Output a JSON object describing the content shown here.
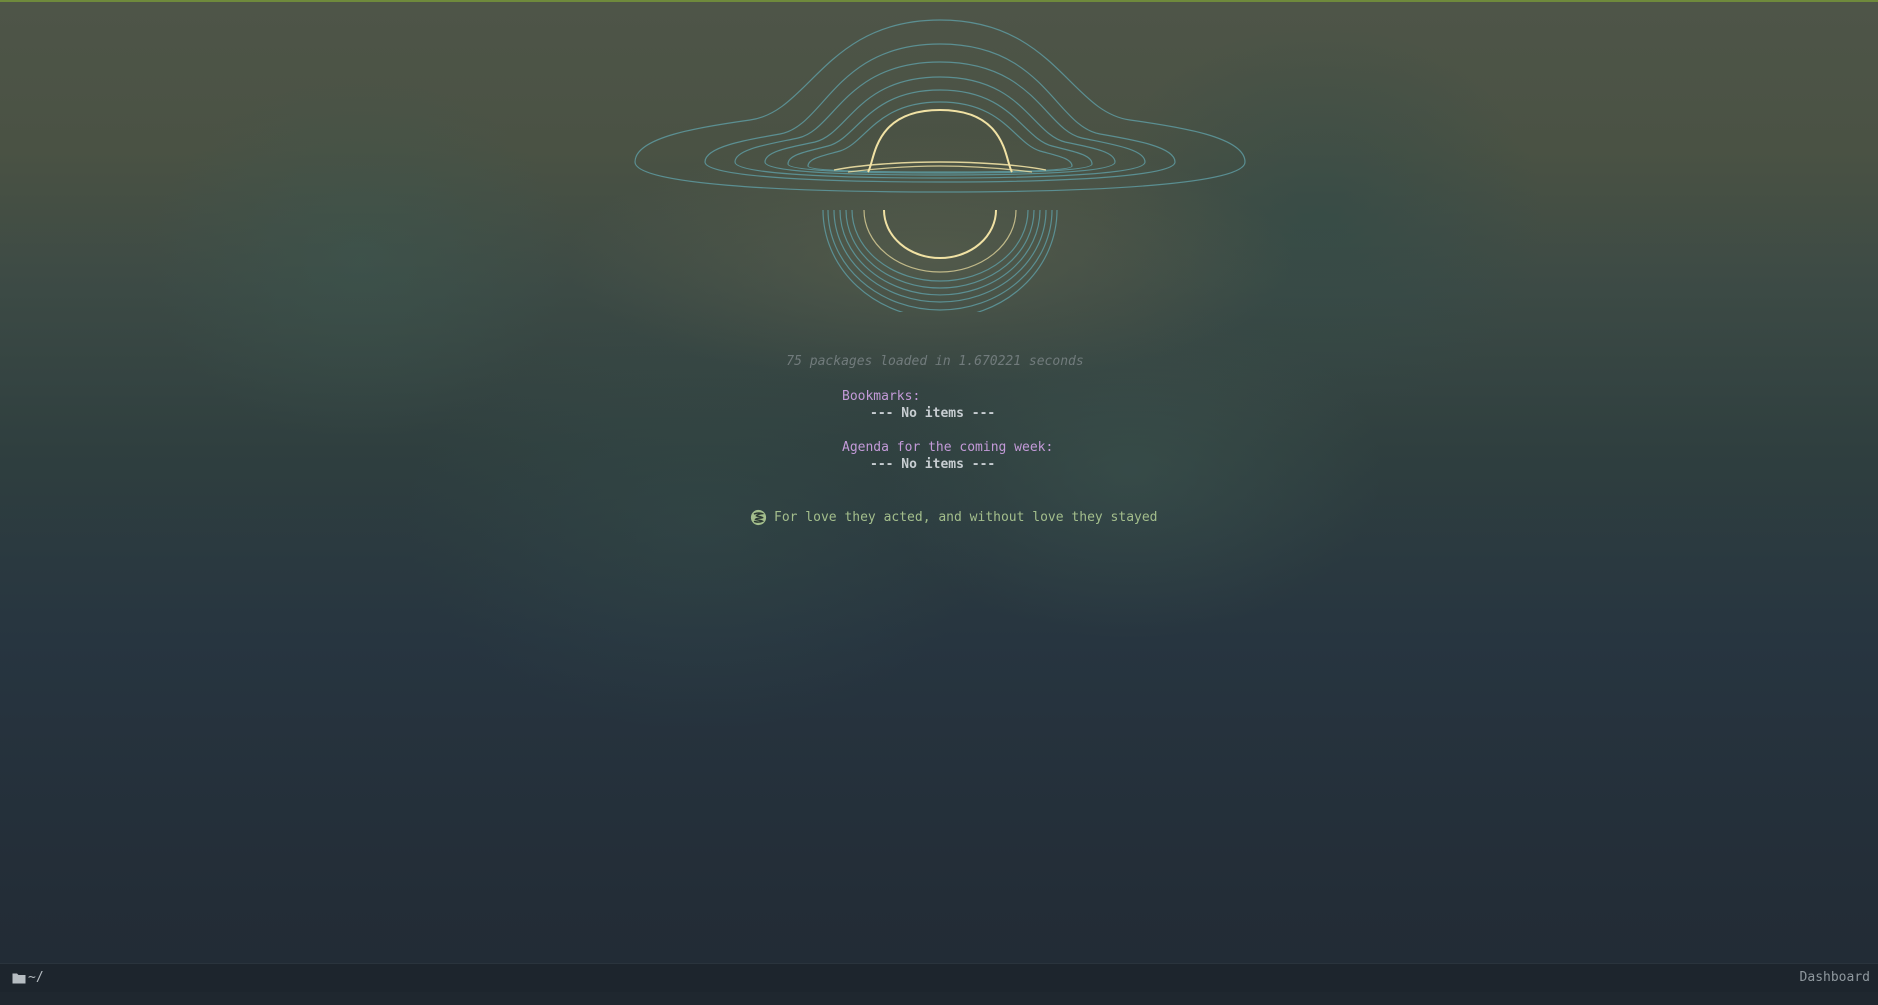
{
  "dashboard": {
    "load_message": "75 packages loaded in 1.670221 seconds",
    "sections": [
      {
        "title": "Bookmarks:",
        "empty_text": "--- No items ---"
      },
      {
        "title": "Agenda for the coming week:",
        "empty_text": "--- No items ---"
      }
    ],
    "footer": {
      "icon": "emacs-logo-icon",
      "text": "For love they acted, and without love they stayed"
    },
    "banner": {
      "icon": "black-hole-banner"
    }
  },
  "modeline": {
    "directory_icon": "folder-icon",
    "directory": "~/",
    "buffer_name": "Dashboard"
  },
  "colors": {
    "section_title": "#c39ad8",
    "footer_text": "#a3be8c",
    "banner_rings": "#5e9aa0",
    "banner_core": "#f1e2a4"
  }
}
